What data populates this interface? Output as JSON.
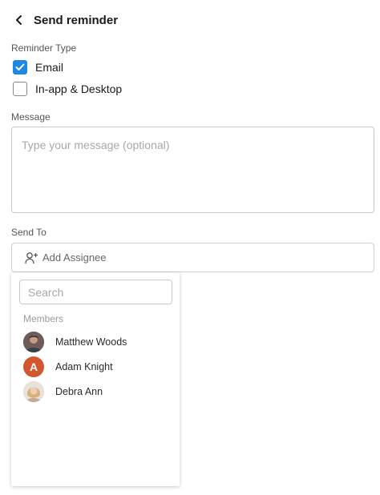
{
  "header": {
    "title": "Send reminder"
  },
  "reminder_type": {
    "label": "Reminder Type",
    "options": [
      {
        "label": "Email",
        "checked": true
      },
      {
        "label": "In-app & Desktop",
        "checked": false
      }
    ]
  },
  "message": {
    "label": "Message",
    "placeholder": "Type your message (optional)",
    "value": ""
  },
  "send_to": {
    "label": "Send To",
    "add_assignee": "Add Assignee"
  },
  "dropdown": {
    "search_placeholder": "Search",
    "members_label": "Members",
    "members": [
      {
        "name": "Matthew Woods",
        "avatar_type": "photo",
        "avatar_color": "#5b4a46"
      },
      {
        "name": "Adam Knight",
        "avatar_type": "initial",
        "initial": "A",
        "avatar_color": "#d2572f"
      },
      {
        "name": "Debra Ann",
        "avatar_type": "photo",
        "avatar_color": "#c9a07e"
      }
    ]
  },
  "colors": {
    "accent": "#1e88e5"
  }
}
